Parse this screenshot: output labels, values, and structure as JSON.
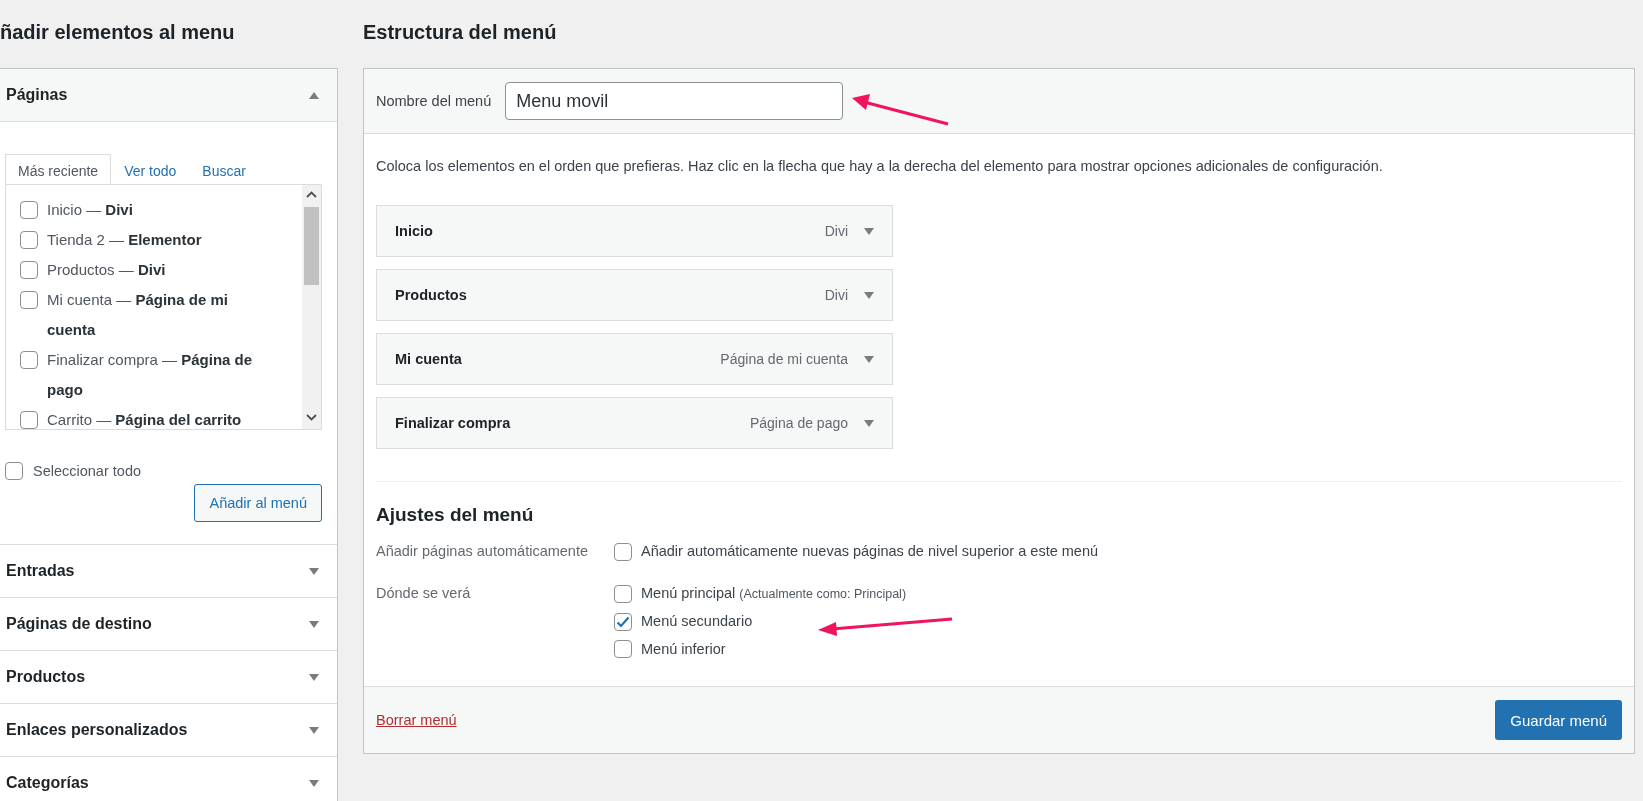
{
  "sidebar": {
    "title": "ñadir elementos al menu",
    "sections": [
      {
        "label": "Páginas",
        "expanded": true,
        "tabs": [
          {
            "label": "Más reciente",
            "selected": true
          },
          {
            "label": "Ver todo",
            "selected": false
          },
          {
            "label": "Buscar",
            "selected": false
          }
        ],
        "items": [
          {
            "label": "Inicio — **Divi**",
            "checked": false
          },
          {
            "label": "Tienda 2 — **Elementor**",
            "checked": false
          },
          {
            "label": "Productos — **Divi**",
            "checked": false
          },
          {
            "label": "Mi cuenta — **Página de mi cuenta**",
            "checked": false
          },
          {
            "label": "Finalizar compra — **Página de pago**",
            "checked": false
          },
          {
            "label": "Carrito — **Página del carrito**",
            "checked": false
          }
        ],
        "select_all": {
          "label": "Seleccionar todo",
          "checked": false
        },
        "add_button": "Añadir al menú"
      },
      {
        "label": "Entradas",
        "expanded": false
      },
      {
        "label": "Páginas de destino",
        "expanded": false
      },
      {
        "label": "Productos",
        "expanded": false
      },
      {
        "label": "Enlaces personalizados",
        "expanded": false
      },
      {
        "label": "Categorías",
        "expanded": false
      }
    ]
  },
  "main": {
    "title": "Estructura del menú",
    "name_label": "Nombre del menú",
    "name_value": "Menu movil",
    "instructions": "Coloca los elementos en el orden que prefieras. Haz clic en la flecha que hay a la derecha del elemento para mostrar opciones adicionales de configuración.",
    "items": [
      {
        "title": "Inicio",
        "type": "Divi"
      },
      {
        "title": "Productos",
        "type": "Divi"
      },
      {
        "title": "Mi cuenta",
        "type": "Página de mi cuenta"
      },
      {
        "title": "Finalizar compra",
        "type": "Página de pago"
      }
    ],
    "settings": {
      "title": "Ajustes del menú",
      "rows": [
        {
          "label": "Añadir páginas automáticamente",
          "options": [
            {
              "label": "Añadir automáticamente nuevas páginas de nivel superior a este menú",
              "checked": false
            }
          ]
        },
        {
          "label": "Dónde se verá",
          "options": [
            {
              "label": "Menú principal",
              "note": "(Actualmente como: Principal)",
              "checked": false
            },
            {
              "label": "Menú secundario",
              "checked": true
            },
            {
              "label": "Menú inferior",
              "checked": false
            }
          ]
        }
      ]
    },
    "delete_link": "Borrar menú",
    "save_button": "Guardar menú"
  }
}
